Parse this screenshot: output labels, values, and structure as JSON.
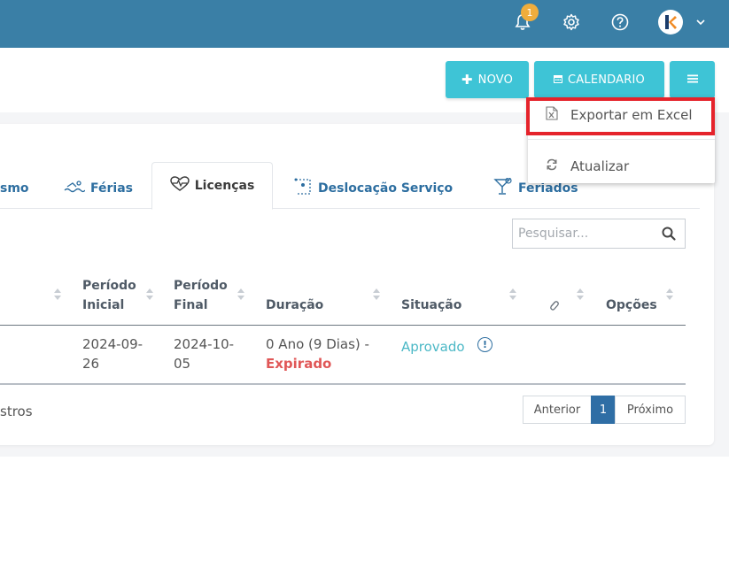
{
  "header": {
    "notification_count": "1",
    "icons": [
      "bell-icon",
      "gear-icon",
      "help-icon",
      "avatar",
      "chevron-down-icon"
    ]
  },
  "actions": {
    "novo_label": "NOVO",
    "calendario_label": "CALENDARIO"
  },
  "dropdown": {
    "items": [
      {
        "label": "Exportar em Excel",
        "icon": "excel-icon"
      },
      {
        "label": "Atualizar",
        "icon": "refresh-icon"
      }
    ]
  },
  "tabs": {
    "items": [
      {
        "label": "smo",
        "icon": ""
      },
      {
        "label": "Férias",
        "icon": "swim-icon"
      },
      {
        "label": "Licenças",
        "icon": "heartbeat-icon",
        "active": true
      },
      {
        "label": "Deslocação Serviço",
        "icon": "route-icon"
      },
      {
        "label": "Feriados",
        "icon": "cocktail-icon"
      }
    ]
  },
  "search": {
    "placeholder": "Pesquisar..."
  },
  "table": {
    "headers": {
      "periodo_inicial": [
        "Período",
        "Inicial"
      ],
      "periodo_final": [
        "Período",
        "Final"
      ],
      "duracao": "Duração",
      "situacao": "Situação",
      "opcoes": "Opções"
    },
    "rows": [
      {
        "periodo_inicial": [
          "2024-09-",
          "26"
        ],
        "periodo_final": [
          "2024-10-",
          "05"
        ],
        "duracao": "0 Ano (9 Dias) -",
        "duracao_status": "Expirado",
        "situacao": "Aprovado",
        "info": "!"
      }
    ]
  },
  "footer": {
    "records_text": "stros"
  },
  "pagination": {
    "prev": "Anterior",
    "current": "1",
    "next": "Próximo"
  },
  "colors": {
    "topbar": "#3a7fa6",
    "button": "#3ec4d6",
    "expired": "#e05757",
    "status": "#4bb8c6",
    "highlight": "#e5232b",
    "tab_text": "#2d6ea0"
  }
}
